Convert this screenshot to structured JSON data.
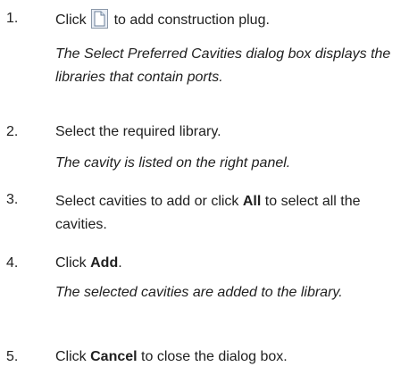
{
  "steps": [
    {
      "number": "1.",
      "pre": "Click",
      "icon": "new-document-icon",
      "post": "to add construction plug.",
      "note": "The Select Preferred Cavities dialog box displays the libraries that contain ports."
    },
    {
      "number": "2.",
      "text": "Select the required library.",
      "note": "The cavity is listed on the right panel."
    },
    {
      "number": "3.",
      "pre": "Select cavities to add or click",
      "bold": "All",
      "post": "to select all the cavities."
    },
    {
      "number": "4.",
      "pre": "Click",
      "bold": "Add",
      "post": ".",
      "note": "The selected cavities are added to the library."
    },
    {
      "number": "5.",
      "pre": "Click",
      "bold": "Cancel",
      "post": "to close the dialog box."
    }
  ]
}
